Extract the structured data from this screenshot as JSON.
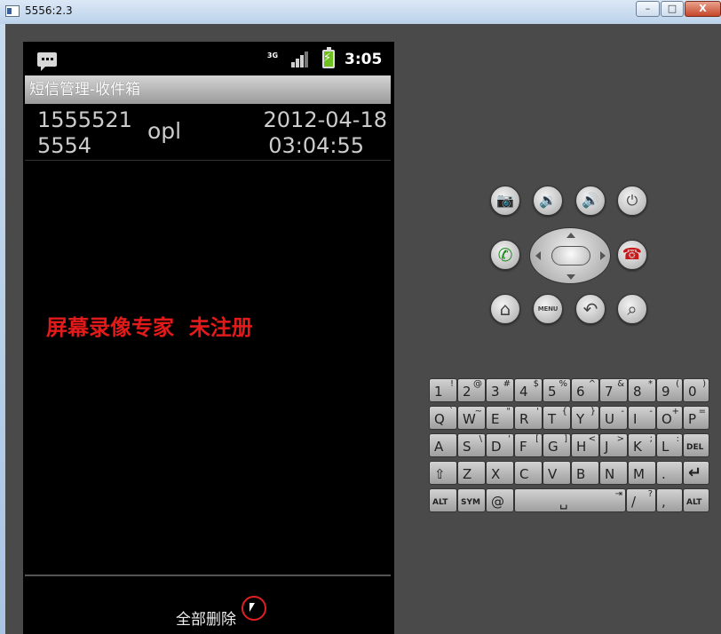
{
  "window": {
    "title": "5556:2.3",
    "min_label": "–",
    "max_label": "□",
    "close_label": "X"
  },
  "statusbar": {
    "network_label": "3G",
    "time": "3:05"
  },
  "app": {
    "title": "短信管理-收件箱"
  },
  "messages": [
    {
      "number": "15555215554",
      "name": "opl",
      "date": "2012-04-18",
      "time": "03:04:55"
    }
  ],
  "watermark": "屏幕录像专家  未注册",
  "bottom": {
    "delete_all_label": "全部删除"
  },
  "hardware": {
    "camera": "📷",
    "vol_down": "🔉",
    "vol_up": "🔊",
    "power": "⏻",
    "call": "✆",
    "end_call": "☎",
    "home": "⌂",
    "menu": "MENU",
    "back": "↶",
    "search": "⌕"
  },
  "keyboard": {
    "row1": [
      [
        "1",
        "!"
      ],
      [
        "2",
        "@"
      ],
      [
        "3",
        "#"
      ],
      [
        "4",
        "$"
      ],
      [
        "5",
        "%"
      ],
      [
        "6",
        "^"
      ],
      [
        "7",
        "&"
      ],
      [
        "8",
        "*"
      ],
      [
        "9",
        "("
      ],
      [
        "0",
        ")"
      ]
    ],
    "row2": [
      [
        "Q",
        "`"
      ],
      [
        "W",
        "~"
      ],
      [
        "E",
        "\""
      ],
      [
        "R",
        "'"
      ],
      [
        "T",
        "{"
      ],
      [
        "Y",
        "}"
      ],
      [
        "U",
        "-"
      ],
      [
        "I",
        "-"
      ],
      [
        "O",
        "+"
      ],
      [
        "P",
        "="
      ]
    ],
    "row3": [
      [
        "A",
        ""
      ],
      [
        "S",
        "\\"
      ],
      [
        "D",
        "'"
      ],
      [
        "F",
        "["
      ],
      [
        "G",
        "]"
      ],
      [
        "H",
        "<"
      ],
      [
        "J",
        ">"
      ],
      [
        "K",
        ";"
      ],
      [
        "L",
        ":"
      ],
      [
        "DEL",
        ""
      ]
    ],
    "row4": [
      [
        "⇧",
        ""
      ],
      [
        "Z",
        ""
      ],
      [
        "X",
        ""
      ],
      [
        "C",
        ""
      ],
      [
        "V",
        ""
      ],
      [
        "B",
        ""
      ],
      [
        "N",
        ""
      ],
      [
        "M",
        ""
      ],
      [
        ".",
        ""
      ],
      [
        "↵",
        ""
      ]
    ],
    "row5": [
      [
        "ALT",
        ""
      ],
      [
        "SYM",
        ""
      ],
      [
        "@",
        ""
      ],
      [
        "␣",
        "⇥"
      ],
      [
        "/",
        "?"
      ],
      [
        ",",
        ""
      ],
      [
        "ALT",
        ""
      ]
    ]
  },
  "colors": {
    "watermark": "#e31a1a",
    "cursor_ring": "#e02020",
    "battery": "#6fbf20"
  }
}
